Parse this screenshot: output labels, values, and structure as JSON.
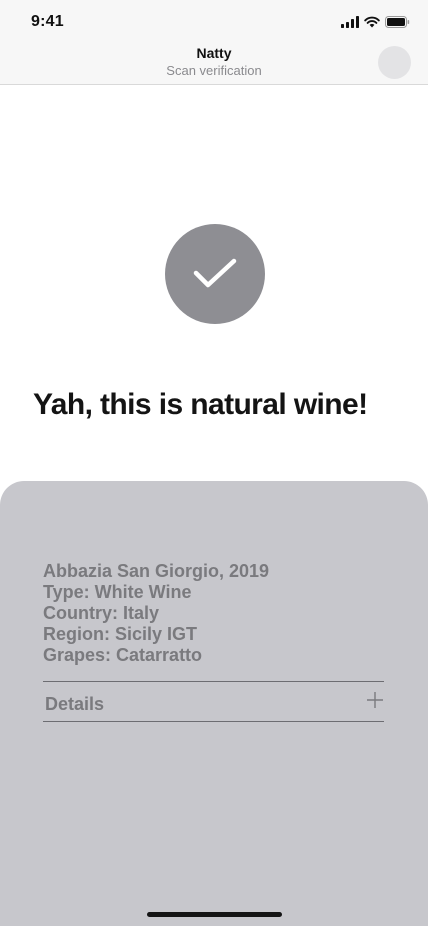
{
  "status_bar": {
    "time": "9:41",
    "icons": [
      "cellular-signal-icon",
      "wifi-icon",
      "battery-icon"
    ]
  },
  "nav": {
    "title": "Natty",
    "subtitle": "Scan verification"
  },
  "result": {
    "icon": "checkmark-icon",
    "headline": "Yah, this is natural wine!"
  },
  "wine": {
    "name_vintage": "Abbazia San Giorgio, 2019",
    "type": "Type: White Wine",
    "country": "Country: Italy",
    "region": "Region: Sicily IGT",
    "grapes": "Grapes: Catarratto"
  },
  "details": {
    "label": "Details",
    "icon": "plus-icon"
  },
  "colors": {
    "check_circle": "#8e8e93",
    "card_background": "#c7c7cc",
    "card_text": "#7a7a7e",
    "nav_background": "#f7f7f7"
  }
}
